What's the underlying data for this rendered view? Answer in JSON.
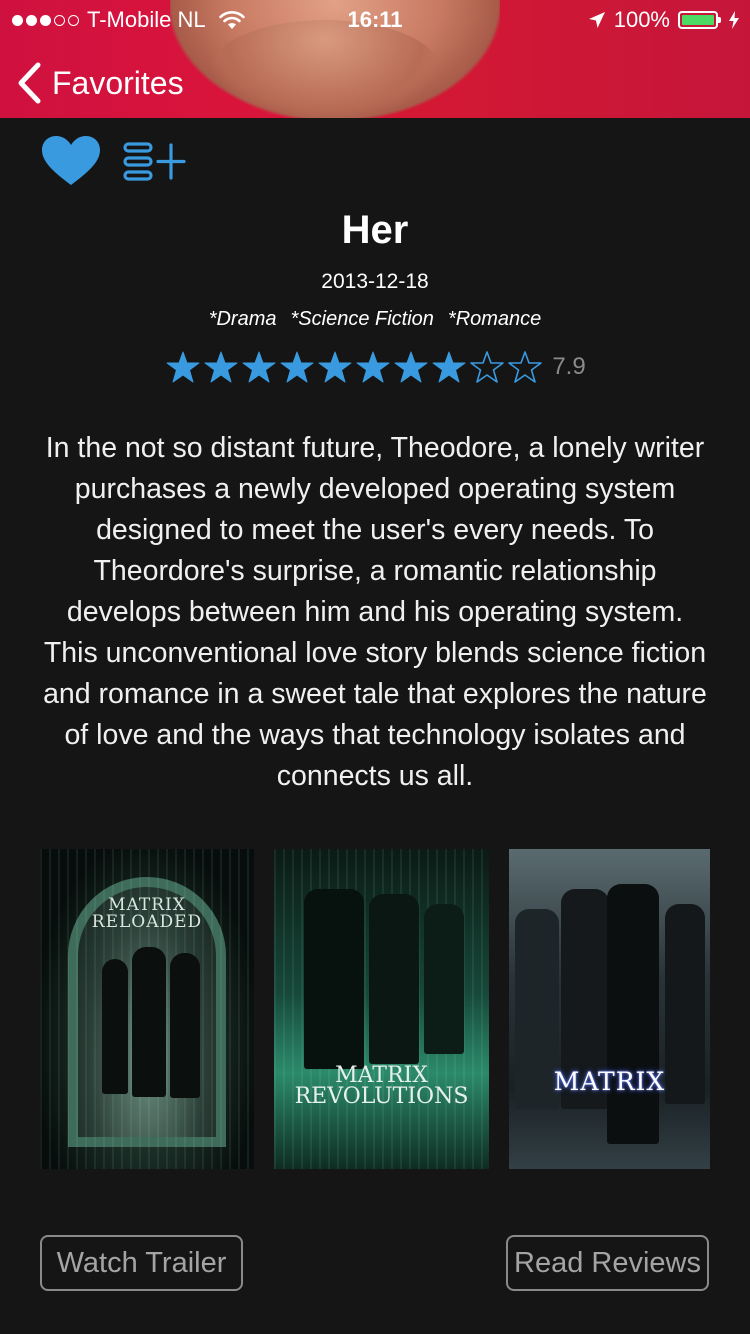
{
  "status_bar": {
    "carrier": "T-Mobile NL",
    "time": "16:11",
    "battery": "100%",
    "signal_dots_filled": 3,
    "signal_dots_total": 5
  },
  "nav": {
    "back_label": "Favorites"
  },
  "actions": {
    "favorite_icon": "heart-icon",
    "add_to_list_icon": "list-add-icon",
    "accent_color": "#3a9ae0"
  },
  "movie": {
    "title": "Her",
    "release_date": "2013-12-18",
    "genres": [
      "*Drama",
      "*Science Fiction",
      "*Romance"
    ],
    "rating": "7.9",
    "stars_filled": 8,
    "stars_total": 10,
    "overview": "In the not so distant future, Theodore, a lonely writer purchases a newly developed operating system designed to meet the user's every needs. To Theordore's surprise, a romantic relationship develops between him and his operating system. This unconventional love story blends science fiction and romance in a sweet tale that explores the nature of love and the ways that technology isolates and connects us all."
  },
  "related_posters": [
    {
      "title_line1": "MATRIX",
      "title_line2": "RELOADED"
    },
    {
      "title_line1": "MATRIX",
      "title_line2": "REVOLUTIONS"
    },
    {
      "title_line1": "MATRIX",
      "title_line2": ""
    }
  ],
  "buttons": {
    "watch_trailer": "Watch Trailer",
    "read_reviews": "Read Reviews"
  }
}
